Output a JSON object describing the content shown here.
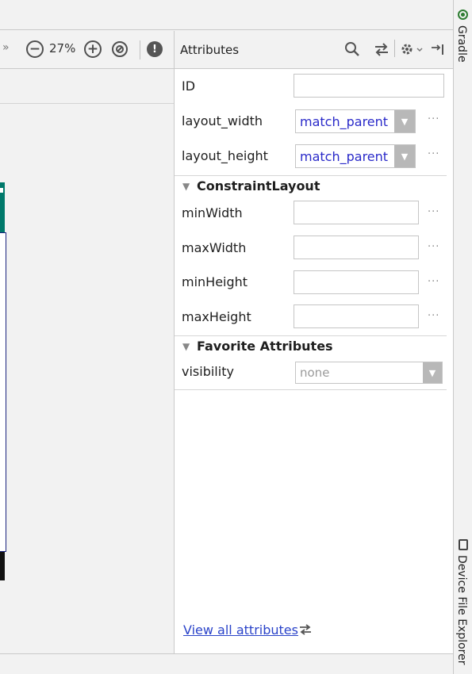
{
  "toolbar": {
    "overflow_chevron": "»",
    "zoom_out_glyph": "−",
    "zoom_level": "27%",
    "zoom_in_glyph": "+",
    "warning_glyph": "!"
  },
  "attributes_panel": {
    "title": "Attributes",
    "header_icons": [
      "search-icon",
      "swap-arrows-icon",
      "gear-icon",
      "pin-right-icon"
    ],
    "id_row": {
      "label": "ID",
      "value": ""
    },
    "layout_width": {
      "label": "layout_width",
      "value": "match_parent",
      "more": "···"
    },
    "layout_height": {
      "label": "layout_height",
      "value": "match_parent",
      "more": "···"
    },
    "constraint_section": {
      "title": "ConstraintLayout",
      "rows": [
        {
          "label": "minWidth",
          "value": "",
          "more": "···"
        },
        {
          "label": "maxWidth",
          "value": "",
          "more": "···"
        },
        {
          "label": "minHeight",
          "value": "",
          "more": "···"
        },
        {
          "label": "maxHeight",
          "value": "",
          "more": "···"
        }
      ]
    },
    "favorite_section": {
      "title": "Favorite Attributes",
      "visibility": {
        "label": "visibility",
        "value": "none"
      }
    },
    "view_all_link": "View all attributes"
  },
  "side_tabs": {
    "gradle": "Gradle",
    "device_file_explorer": "Device File Explorer"
  },
  "colors": {
    "link": "#2a43c9",
    "combo_value": "#2929c9",
    "device_accent": "#00796b",
    "device_frame": "#1a237e"
  }
}
